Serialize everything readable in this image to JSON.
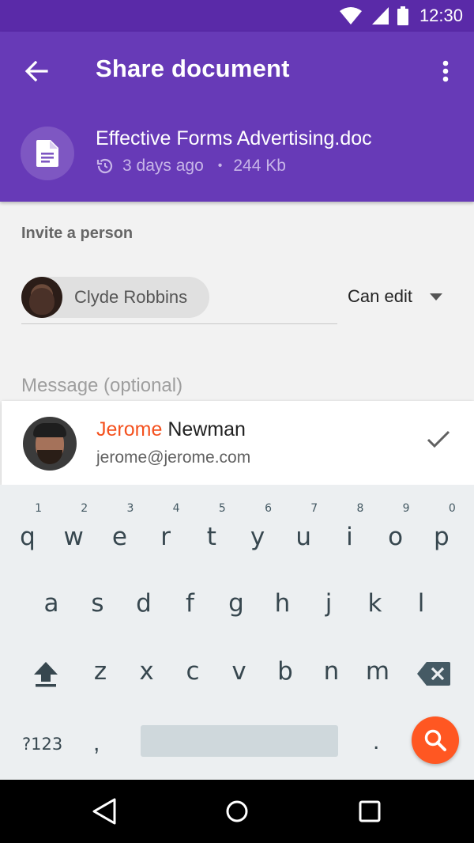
{
  "status_bar": {
    "time": "12:30"
  },
  "app_bar": {
    "title": "Share document",
    "document": {
      "name": "Effective Forms Advertising.doc",
      "modified": "3 days ago",
      "size": "244 Kb"
    }
  },
  "invite": {
    "label": "Invite a person",
    "chip_name": "Clyde Robbins",
    "permission": "Can edit",
    "message_placeholder": "Message (optional)"
  },
  "suggestion": {
    "name_highlight": "Jerome",
    "name_rest": " Newman",
    "email": "jerome@jerome.com"
  },
  "keyboard": {
    "row1": [
      {
        "key": "q",
        "hint": "1"
      },
      {
        "key": "w",
        "hint": "2"
      },
      {
        "key": "e",
        "hint": "3"
      },
      {
        "key": "r",
        "hint": "4"
      },
      {
        "key": "t",
        "hint": "5"
      },
      {
        "key": "y",
        "hint": "6"
      },
      {
        "key": "u",
        "hint": "7"
      },
      {
        "key": "i",
        "hint": "8"
      },
      {
        "key": "o",
        "hint": "9"
      },
      {
        "key": "p",
        "hint": "0"
      }
    ],
    "row2": [
      "a",
      "s",
      "d",
      "f",
      "g",
      "h",
      "j",
      "k",
      "l"
    ],
    "row3": [
      "z",
      "x",
      "c",
      "v",
      "b",
      "n",
      "m"
    ],
    "symbols_label": "?123",
    "comma": ",",
    "period": "."
  },
  "colors": {
    "primary": "#673ab7",
    "primary_dark": "#5a2aa8",
    "accent": "#ff5722",
    "highlight": "#f4511e"
  },
  "icons": [
    "back-arrow-icon",
    "more-vert-icon",
    "document-icon",
    "history-icon",
    "dropdown-caret-icon",
    "check-icon",
    "shift-icon",
    "backspace-icon",
    "search-icon",
    "nav-back-icon",
    "nav-home-icon",
    "nav-recents-icon",
    "wifi-icon",
    "signal-icon",
    "battery-icon"
  ]
}
